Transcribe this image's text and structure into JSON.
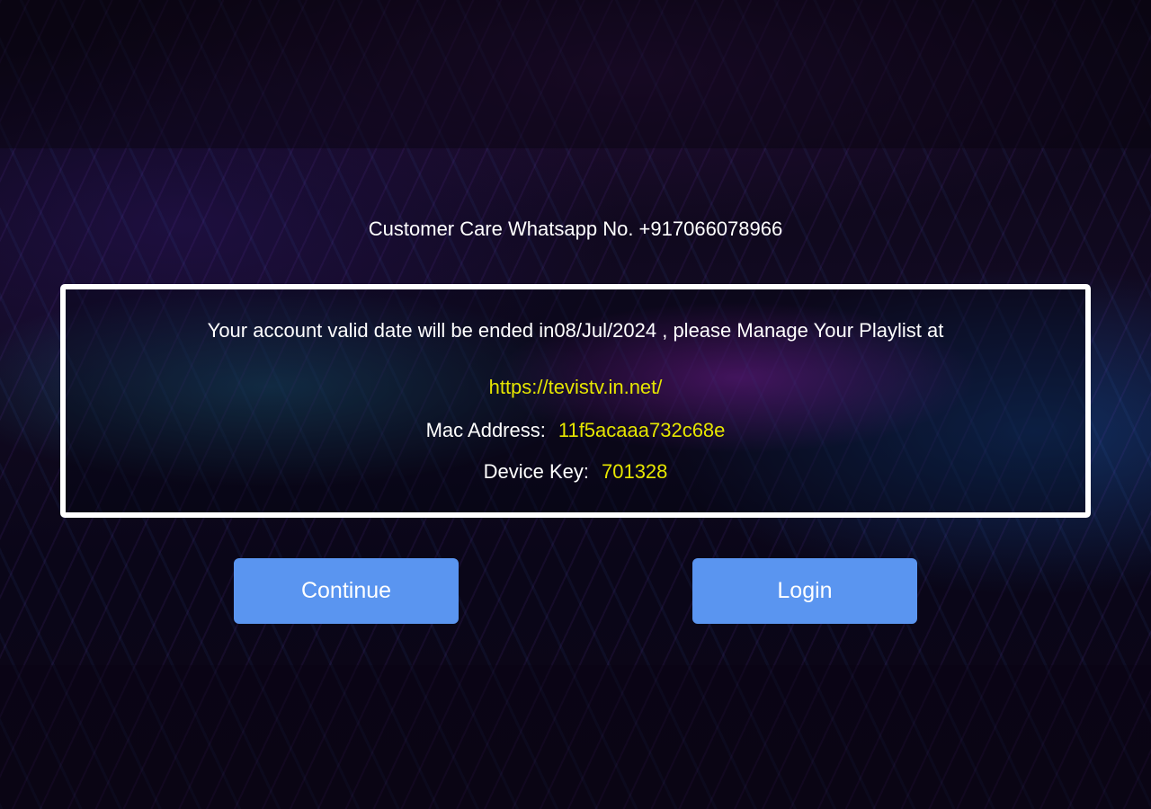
{
  "support": {
    "whatsapp_text": "Customer Care Whatsapp No. +917066078966"
  },
  "account": {
    "expiry_message": "Your account valid date will be ended in08/Jul/2024 , please Manage Your Playlist at",
    "playlist_url": "https://tevistv.in.net/",
    "mac_label": "Mac Address:",
    "mac_value": "11f5acaaa732c68e",
    "device_key_label": "Device Key:",
    "device_key_value": "701328"
  },
  "buttons": {
    "continue_label": "Continue",
    "login_label": "Login"
  },
  "colors": {
    "highlight": "#e6e600",
    "button": "#5a95f0",
    "text": "#ffffff"
  }
}
